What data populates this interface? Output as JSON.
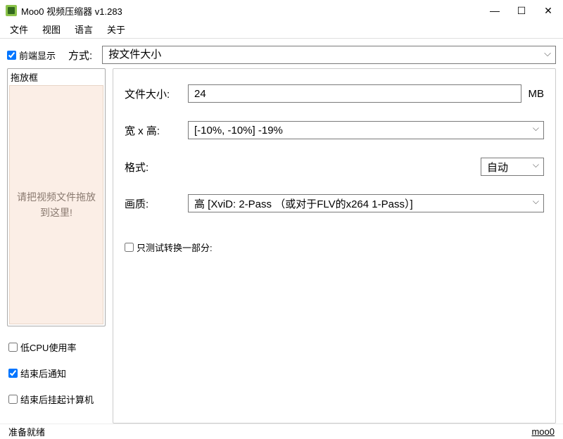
{
  "window": {
    "title": "Moo0 视频压缩器 v1.283"
  },
  "menu": {
    "file": "文件",
    "view": "视图",
    "language": "语言",
    "about": "关于"
  },
  "top": {
    "front_display": "前端显示",
    "method_label": "方式:",
    "method_value": "按文件大小"
  },
  "dropbox": {
    "title": "拖放框",
    "hint": "请把视频文件拖放到这里!"
  },
  "options": {
    "low_cpu": "低CPU使用率",
    "notify_done": "结束后通知",
    "suspend_done": "结束后挂起计算机"
  },
  "fields": {
    "filesize_label": "文件大小:",
    "filesize_value": "24",
    "filesize_unit": "MB",
    "dim_label": "宽 x 高:",
    "dim_value": "[-10%, -10%]    -19%",
    "format_label": "格式:",
    "format_value": "自动",
    "quality_label": "画质:",
    "quality_value": "高      [XviD: 2-Pass   （或对于FLV的x264 1-Pass）]",
    "test_label": "只测试转换一部分:"
  },
  "status": {
    "ready": "准备就绪",
    "link": "moo0"
  }
}
